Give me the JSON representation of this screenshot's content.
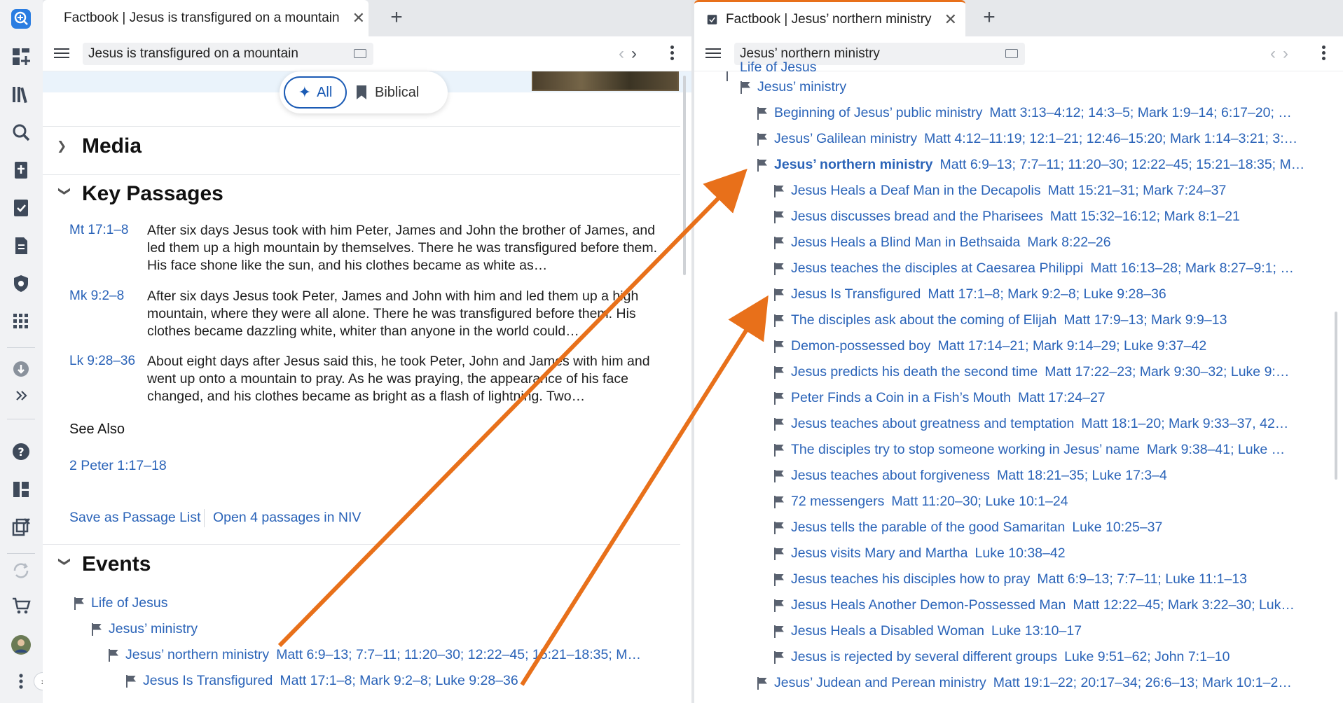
{
  "left": {
    "tab_title": "Factbook | Jesus is transfigured on a mountain",
    "address": "Jesus is transfigured on a mountain",
    "filter": {
      "all": "All",
      "biblical": "Biblical"
    },
    "media": "Media",
    "key_passages": "Key Passages",
    "passages": [
      {
        "ref": "Mt 17:1–8",
        "text": "After six days Jesus took with him Peter, James and John the brother of James, and led them up a high mountain by themselves. There he was transfigured before them. His face shone like the sun, and his clothes became as white as…"
      },
      {
        "ref": "Mk 9:2–8",
        "text": "After six days Jesus took Peter, James and John with him and led them up a high mountain, where they were all alone. There he was transfigured before them. His clothes became dazzling white, whiter than anyone in the world could…"
      },
      {
        "ref": "Lk 9:28–36",
        "text": "About eight days after Jesus said this, he took Peter, John and James with him and went up onto a mountain to pray. As he was praying, the appearance of his face changed, and his clothes became as bright as a flash of lightning. Two…"
      }
    ],
    "see_also": "See Also",
    "see_also_link": "2 Peter 1:17–18",
    "save_list": "Save as Passage List",
    "open_niv": "Open 4 passages in NIV",
    "events": "Events",
    "events_tree": [
      {
        "title": "Life of Jesus",
        "refs": ""
      },
      {
        "title": "Jesus’ ministry",
        "refs": ""
      },
      {
        "title": "Jesus’ northern ministry",
        "refs": "Matt 6:9–13; 7:7–11; 11:20–30; 12:22–45; 15:21–18:35; M…"
      },
      {
        "title": "Jesus Is Transfigured",
        "refs": "Matt 17:1–8; Mark 9:2–8; Luke 9:28–36"
      }
    ]
  },
  "right": {
    "tab_title": "Factbook | Jesus’ northern ministry",
    "address": "Jesus’ northern ministry",
    "top_partial": "Life of Jesus",
    "ministry": "Jesus’ ministry",
    "level2": [
      {
        "title": "Beginning of Jesus’ public ministry",
        "refs": "Matt 3:13–4:12; 14:3–5; Mark 1:9–14; 6:17–20; …"
      },
      {
        "title": "Jesus’ Galilean ministry",
        "refs": "Matt 4:12–11:19; 12:1–21; 12:46–15:20; Mark 1:14–3:21; 3:…"
      },
      {
        "title": "Jesus’ northern ministry",
        "refs": "Matt 6:9–13; 7:7–11; 11:20–30; 12:22–45; 15:21–18:35; M…"
      }
    ],
    "children": [
      {
        "title": "Jesus Heals a Deaf Man in the Decapolis",
        "refs": "Matt 15:21–31; Mark 7:24–37"
      },
      {
        "title": "Jesus discusses bread and the Pharisees",
        "refs": "Matt 15:32–16:12; Mark 8:1–21"
      },
      {
        "title": "Jesus Heals a Blind Man in Bethsaida",
        "refs": "Mark 8:22–26"
      },
      {
        "title": "Jesus teaches the disciples at Caesarea Philippi",
        "refs": "Matt 16:13–28; Mark 8:27–9:1; …"
      },
      {
        "title": "Jesus Is Transfigured",
        "refs": "Matt 17:1–8; Mark 9:2–8; Luke 9:28–36"
      },
      {
        "title": "The disciples ask about the coming of Elijah",
        "refs": "Matt 17:9–13; Mark 9:9–13"
      },
      {
        "title": "Demon-possessed boy",
        "refs": "Matt 17:14–21; Mark 9:14–29; Luke 9:37–42"
      },
      {
        "title": "Jesus predicts his death the second time",
        "refs": "Matt 17:22–23; Mark 9:30–32; Luke 9:…"
      },
      {
        "title": "Peter Finds a Coin in a Fish’s Mouth",
        "refs": "Matt 17:24–27"
      },
      {
        "title": "Jesus teaches about greatness and temptation",
        "refs": "Matt 18:1–20; Mark 9:33–37, 42…"
      },
      {
        "title": "The disciples try to stop someone working in Jesus’ name",
        "refs": "Mark 9:38–41; Luke …"
      },
      {
        "title": "Jesus teaches about forgiveness",
        "refs": "Matt 18:21–35; Luke 17:3–4"
      },
      {
        "title": "72 messengers",
        "refs": "Matt 11:20–30; Luke 10:1–24"
      },
      {
        "title": "Jesus tells the parable of the good Samaritan",
        "refs": "Luke 10:25–37"
      },
      {
        "title": "Jesus visits Mary and Martha",
        "refs": "Luke 10:38–42"
      },
      {
        "title": "Jesus teaches his disciples how to pray",
        "refs": "Matt 6:9–13; 7:7–11; Luke 11:1–13"
      },
      {
        "title": "Jesus Heals Another Demon-Possessed Man",
        "refs": "Matt 12:22–45; Mark 3:22–30; Luk…"
      },
      {
        "title": "Jesus Heals a Disabled Woman",
        "refs": "Luke 13:10–17"
      },
      {
        "title": "Jesus is rejected by several different groups",
        "refs": "Luke 9:51–62; John 7:1–10"
      }
    ],
    "next_level2": {
      "title": "Jesus’ Judean and Perean ministry",
      "refs": "Matt 19:1–22; 20:17–34; 26:6–13; Mark 10:1–2…"
    }
  },
  "colors": {
    "link": "#2a63b8",
    "arrow": "#e8701a",
    "accent": "#1b5bb5"
  }
}
